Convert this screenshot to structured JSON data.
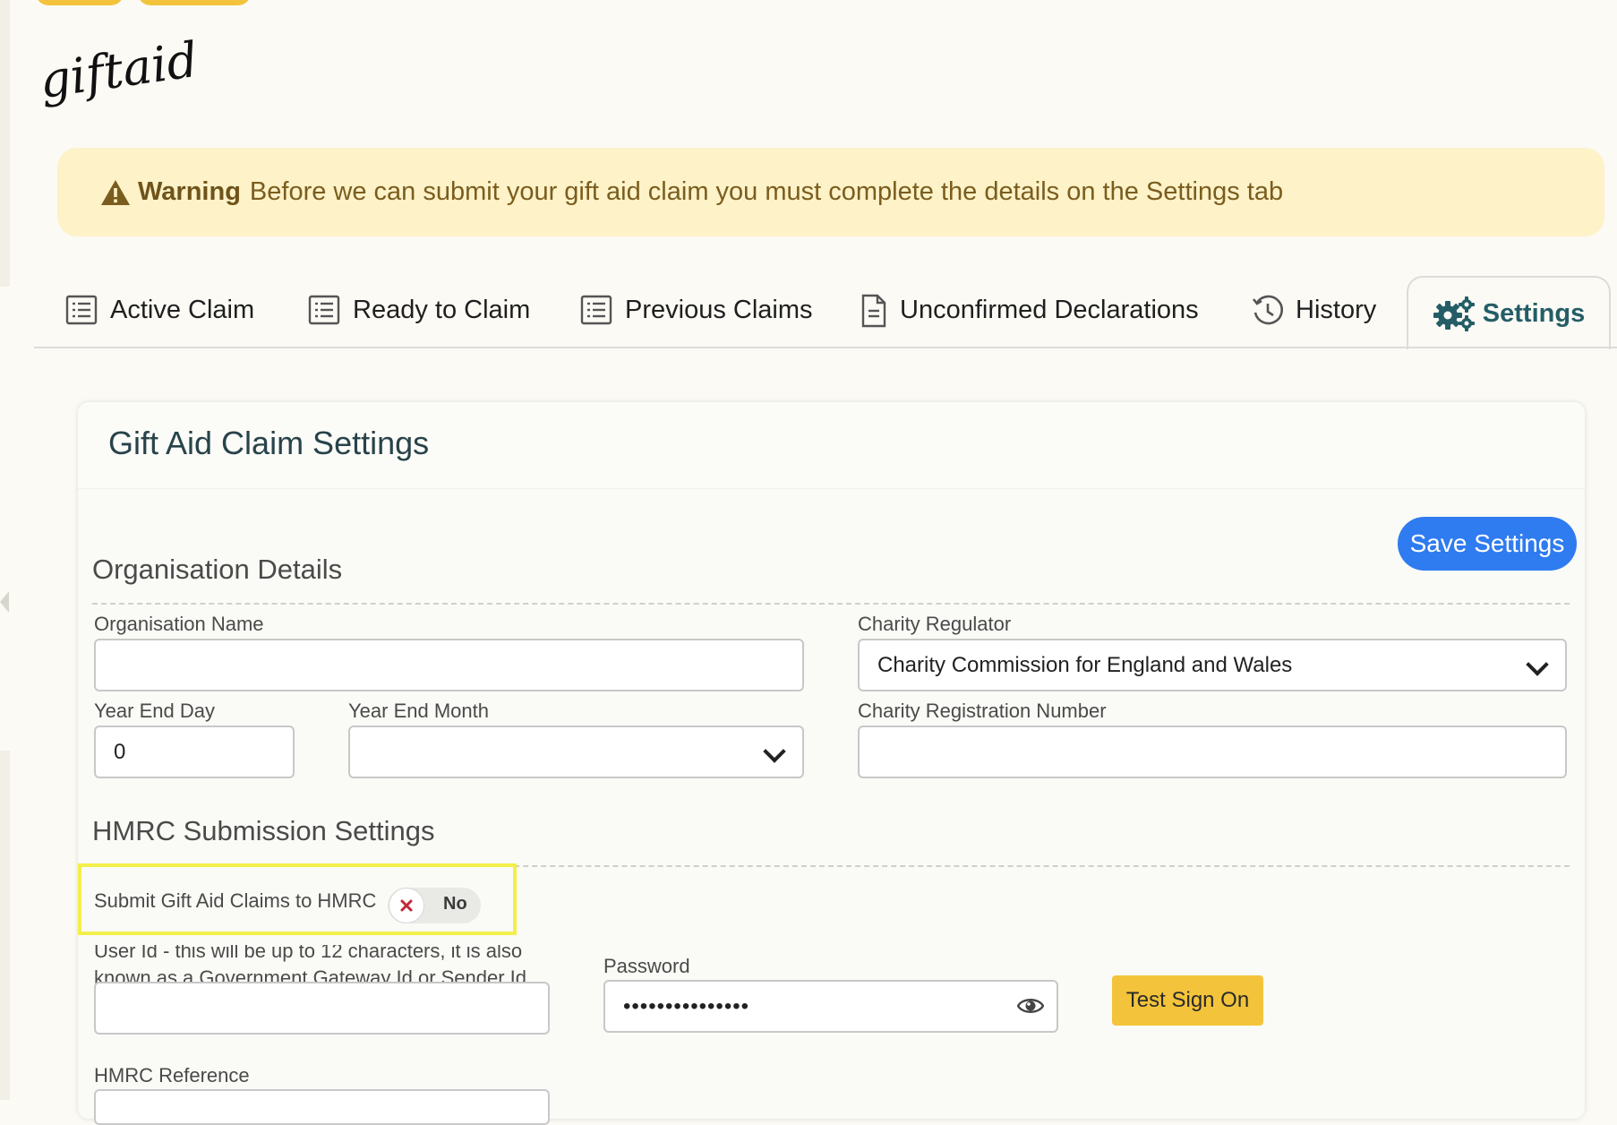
{
  "brand": {
    "logo_text": "giftaid"
  },
  "warning": {
    "label": "Warning",
    "message": "Before we can submit your gift aid claim you must complete the details on the Settings tab"
  },
  "tabs": [
    {
      "label": "Active Claim",
      "icon": "list-icon"
    },
    {
      "label": "Ready to Claim",
      "icon": "list-icon"
    },
    {
      "label": "Previous Claims",
      "icon": "list-icon"
    },
    {
      "label": "Unconfirmed Declarations",
      "icon": "document-icon"
    },
    {
      "label": "History",
      "icon": "history-icon"
    },
    {
      "label": "Settings",
      "icon": "gears-icon",
      "active": true
    }
  ],
  "card": {
    "title": "Gift Aid Claim Settings",
    "save_label": "Save Settings"
  },
  "organisation": {
    "section_title": "Organisation Details",
    "name_label": "Organisation Name",
    "name_value": "",
    "regulator_label": "Charity Regulator",
    "regulator_value": "Charity Commission for England and Wales",
    "year_end_day_label": "Year End Day",
    "year_end_day_value": "0",
    "year_end_month_label": "Year End Month",
    "year_end_month_value": "",
    "reg_number_label": "Charity Registration Number",
    "reg_number_value": ""
  },
  "hmrc": {
    "section_title": "HMRC Submission Settings",
    "submit_label": "Submit Gift Aid Claims to HMRC",
    "submit_toggle": "No",
    "userid_label_line1": "User Id - this will be up to 12 characters, it is also",
    "userid_label_line2": "known as a Government Gateway Id or Sender Id",
    "userid_value": "",
    "password_label": "Password",
    "password_value": "•••••••••••••••",
    "test_label": "Test Sign On",
    "reference_label": "HMRC Reference"
  },
  "colors": {
    "accent_blue": "#2f7bf0",
    "accent_yellow": "#f3c43b",
    "warning_bg": "#fdf2c8",
    "settings_tab": "#245d66"
  }
}
